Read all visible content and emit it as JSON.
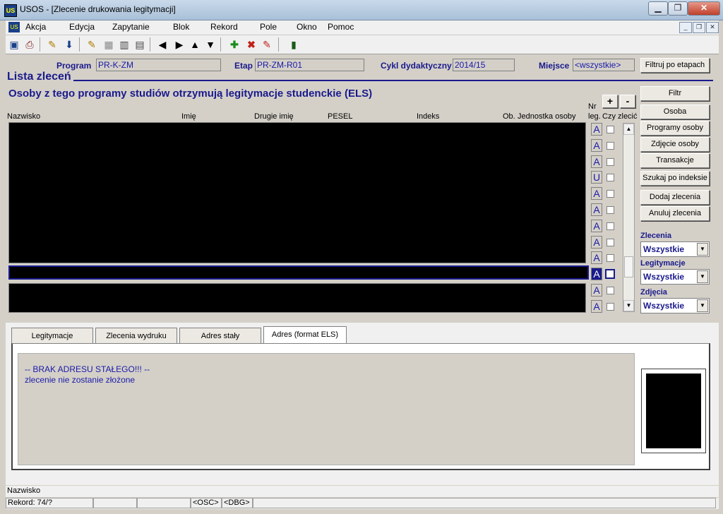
{
  "window": {
    "title": "USOS - [Zlecenie drukowania legitymacji]",
    "minimize": "▁",
    "maximize": "❐",
    "close": "✕"
  },
  "menu": [
    {
      "label": "Akcja"
    },
    {
      "label": "Edycja"
    },
    {
      "label": "Zapytanie"
    },
    {
      "label": "Blok"
    },
    {
      "label": "Rekord"
    },
    {
      "label": "Pole"
    },
    {
      "label": "Okno"
    },
    {
      "label": "Pomoc"
    }
  ],
  "mdi": {
    "minimize": "_",
    "restore": "❐",
    "close": "✕"
  },
  "filters": {
    "program_label": "Program",
    "program_value": "PR-K-ZM",
    "etap_label": "Etap",
    "etap_value": "PR-ZM-R01",
    "cykl_label": "Cykl dydaktyczny",
    "cykl_value": "2014/15",
    "miejsce_label": "Miejsce",
    "miejsce_value": "<wszystkie>",
    "filter_button": "Filtruj po etapach"
  },
  "section_title": "Lista zleceń",
  "subtitle": "Osoby z tego programy studiów otrzymują legitymacje studenckie (ELS)",
  "columns": {
    "nazwisko": "Nazwisko",
    "imie": "Imię",
    "drugie": "Drugie imię",
    "pesel": "PESEL",
    "indeks": "Indeks",
    "ob": "Ob.",
    "jednostka": "Jednostka osoby",
    "nr_top": "Nr",
    "nr_bottom": "leg.",
    "czy": "Czy zlecić"
  },
  "plus_label": "+",
  "minus_label": "-",
  "rows": [
    {
      "leg": "A"
    },
    {
      "leg": "A"
    },
    {
      "leg": "A"
    },
    {
      "leg": "U"
    },
    {
      "leg": "A"
    },
    {
      "leg": "A"
    },
    {
      "leg": "A"
    },
    {
      "leg": "A"
    },
    {
      "leg": "A"
    },
    {
      "leg": "A"
    },
    {
      "leg": "A"
    },
    {
      "leg": "A"
    }
  ],
  "side_buttons": {
    "filtr": "Filtr",
    "osoba": "Osoba",
    "programy": "Programy osoby",
    "zdjecie": "Zdjęcie osoby",
    "transakcje": "Transakcje",
    "szukaj": "Szukaj po indeksie",
    "dodaj": "Dodaj zlecenia",
    "anuluj": "Anuluj zlecenia"
  },
  "dropdowns": {
    "zlecenia_label": "Zlecenia",
    "zlecenia_value": "Wszystkie",
    "legitymacje_label": "Legitymacje",
    "legitymacje_value": "Wszystkie",
    "zdjecia_label": "Zdjęcia",
    "zdjecia_value": "Wszystkie"
  },
  "tabs": [
    {
      "label": "Legitymacje"
    },
    {
      "label": "Zlecenia wydruku"
    },
    {
      "label": "Adres stały"
    },
    {
      "label": "Adres (format ELS)"
    }
  ],
  "address": {
    "line1": "-- BRAK ADRESU STAŁEGO!!! --",
    "line2": "zlecenie nie zostanie złożone"
  },
  "status": {
    "field": "Nazwisko",
    "record": "Rekord: 74/?",
    "osc": "<OSC>",
    "dbg": "<DBG>"
  },
  "colors": {
    "accent": "#1a1a8c",
    "field_text": "#1a1aa8"
  }
}
